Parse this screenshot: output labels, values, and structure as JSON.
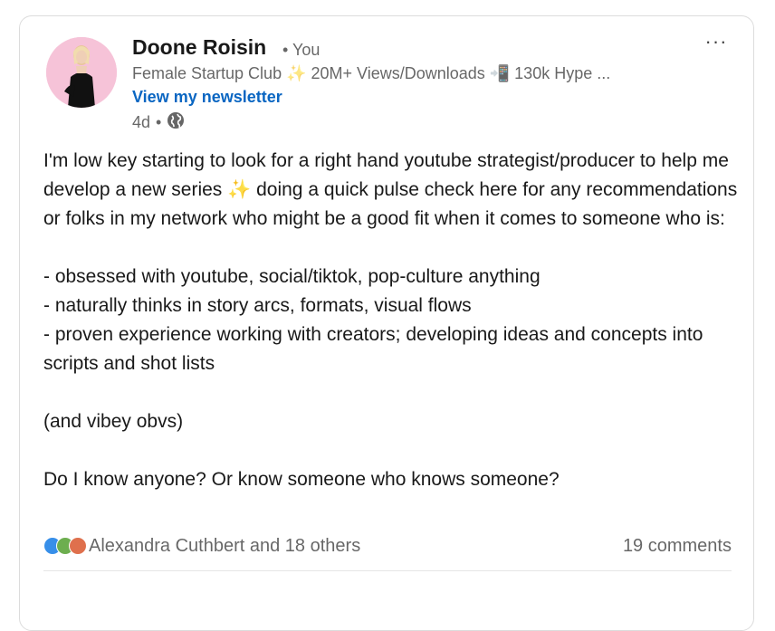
{
  "post": {
    "author": {
      "name": "Doone Roisin",
      "degree": "• You",
      "headline": "Female Startup Club ✨ 20M+ Views/Downloads 📲 130k Hype ...",
      "newsletter_link": "View my newsletter"
    },
    "meta": {
      "time": "4d",
      "separator": "•",
      "visibility_icon": "globe-icon"
    },
    "more_menu_label": "···",
    "body": {
      "intro": "I'm low key starting to look for a right hand youtube strategist/producer to help me develop a new series ✨ doing a quick pulse check here for any recommendations or folks in my network who might be a good fit when it comes to someone who is:",
      "bullets": [
        "- obsessed with youtube, social/tiktok, pop-culture anything",
        "- naturally thinks in story arcs, formats, visual flows",
        "- proven experience working with creators; developing ideas and concepts into scripts and shot lists"
      ],
      "aside": "(and vibey obvs)",
      "closing": "Do I know anyone? Or know someone who knows someone?"
    },
    "social": {
      "reaction_icons": [
        "like-icon",
        "celebrate-icon",
        "love-icon"
      ],
      "reactions_text": "Alexandra Cuthbert and 18 others",
      "comments_text": "19 comments"
    },
    "colors": {
      "link": "#0a66c2",
      "like": "#378fe9",
      "celebrate": "#6dae4f",
      "love": "#df704d"
    }
  }
}
